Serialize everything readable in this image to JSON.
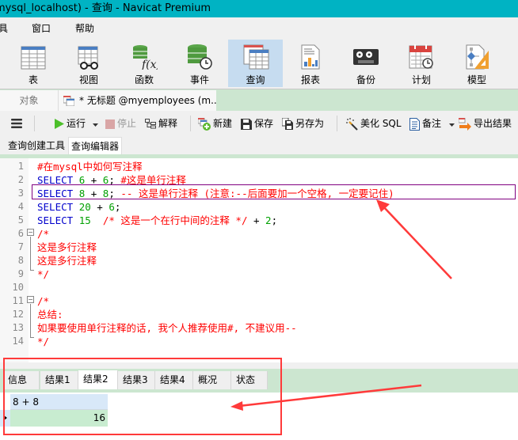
{
  "window": {
    "title": "mysql_localhost) - 查询 - Navicat Premium"
  },
  "menu": {
    "items": [
      "具",
      "窗口",
      "帮助"
    ]
  },
  "ribbon": {
    "items": [
      {
        "label": "表",
        "icon": "table-icon"
      },
      {
        "label": "视图",
        "icon": "view-icon"
      },
      {
        "label": "函数",
        "icon": "function-icon"
      },
      {
        "label": "事件",
        "icon": "event-icon"
      },
      {
        "label": "查询",
        "icon": "query-icon",
        "active": true
      },
      {
        "label": "报表",
        "icon": "report-icon"
      },
      {
        "label": "备份",
        "icon": "backup-icon"
      },
      {
        "label": "计划",
        "icon": "schedule-icon"
      },
      {
        "label": "模型",
        "icon": "model-icon"
      }
    ]
  },
  "tabs": {
    "objects": "对象",
    "query": "* 无标题 @myemployees (m..."
  },
  "toolbar": {
    "run": "运行",
    "stop": "停止",
    "explain": "解释",
    "new": "新建",
    "save": "保存",
    "save_as": "另存为",
    "beautify": "美化 SQL",
    "notes": "备注",
    "export": "导出结果"
  },
  "subtabs": {
    "builder": "查询创建工具",
    "editor": "查询编辑器"
  },
  "editor": {
    "lines": [
      {
        "n": "1",
        "parts": [
          {
            "t": "#在mysql中如何写注释",
            "c": "cm"
          }
        ]
      },
      {
        "n": "2",
        "parts": [
          {
            "t": "SELECT",
            "c": "kw"
          },
          {
            "t": " ",
            "c": "op"
          },
          {
            "t": "6",
            "c": "num"
          },
          {
            "t": " + ",
            "c": "op"
          },
          {
            "t": "6",
            "c": "num"
          },
          {
            "t": "; ",
            "c": "op"
          },
          {
            "t": "#这是单行注释",
            "c": "cm"
          }
        ]
      },
      {
        "n": "3",
        "parts": [
          {
            "t": "SELECT",
            "c": "kw"
          },
          {
            "t": " ",
            "c": "op"
          },
          {
            "t": "8",
            "c": "num"
          },
          {
            "t": " + ",
            "c": "op"
          },
          {
            "t": "8",
            "c": "num"
          },
          {
            "t": "; ",
            "c": "op"
          },
          {
            "t": "-- 这是单行注释 (注意:--后面要加一个空格, 一定要记住)",
            "c": "cm"
          }
        ]
      },
      {
        "n": "4",
        "parts": [
          {
            "t": "SELECT",
            "c": "kw"
          },
          {
            "t": " ",
            "c": "op"
          },
          {
            "t": "20",
            "c": "num"
          },
          {
            "t": " + ",
            "c": "op"
          },
          {
            "t": "6",
            "c": "num"
          },
          {
            "t": ";",
            "c": "op"
          }
        ]
      },
      {
        "n": "5",
        "parts": [
          {
            "t": "SELECT",
            "c": "kw"
          },
          {
            "t": " ",
            "c": "op"
          },
          {
            "t": "15",
            "c": "num"
          },
          {
            "t": "  ",
            "c": "op"
          },
          {
            "t": "/* 这是一个在行中间的注释 */",
            "c": "cm"
          },
          {
            "t": " + ",
            "c": "op"
          },
          {
            "t": "2",
            "c": "num"
          },
          {
            "t": ";",
            "c": "op"
          }
        ]
      },
      {
        "n": "6",
        "parts": [
          {
            "t": "/*",
            "c": "cm"
          }
        ]
      },
      {
        "n": "7",
        "parts": [
          {
            "t": "这是多行注释",
            "c": "cm"
          }
        ]
      },
      {
        "n": "8",
        "parts": [
          {
            "t": "这是多行注释",
            "c": "cm"
          }
        ]
      },
      {
        "n": "9",
        "parts": [
          {
            "t": "*/",
            "c": "cm"
          }
        ]
      },
      {
        "n": "10",
        "parts": []
      },
      {
        "n": "11",
        "parts": [
          {
            "t": "/*",
            "c": "cm"
          }
        ]
      },
      {
        "n": "12",
        "parts": [
          {
            "t": "总结:",
            "c": "cm"
          }
        ]
      },
      {
        "n": "13",
        "parts": [
          {
            "t": "如果要使用单行注释的话, 我个人推荐使用#, 不建议用--",
            "c": "cm"
          }
        ]
      },
      {
        "n": "14",
        "parts": [
          {
            "t": "*/",
            "c": "cm"
          }
        ]
      }
    ]
  },
  "results": {
    "tabs": [
      "信息",
      "结果1",
      "结果2",
      "结果3",
      "结果4",
      "概况",
      "状态"
    ],
    "active_tab": "结果2",
    "columns": [
      "8 + 8"
    ],
    "rows": [
      [
        "16"
      ]
    ]
  },
  "colors": {
    "titlebar": "#00b3c3",
    "accent_green": "#cce6d0",
    "annotation_red": "#ff3a3a",
    "highlight_purple": "#800080"
  }
}
